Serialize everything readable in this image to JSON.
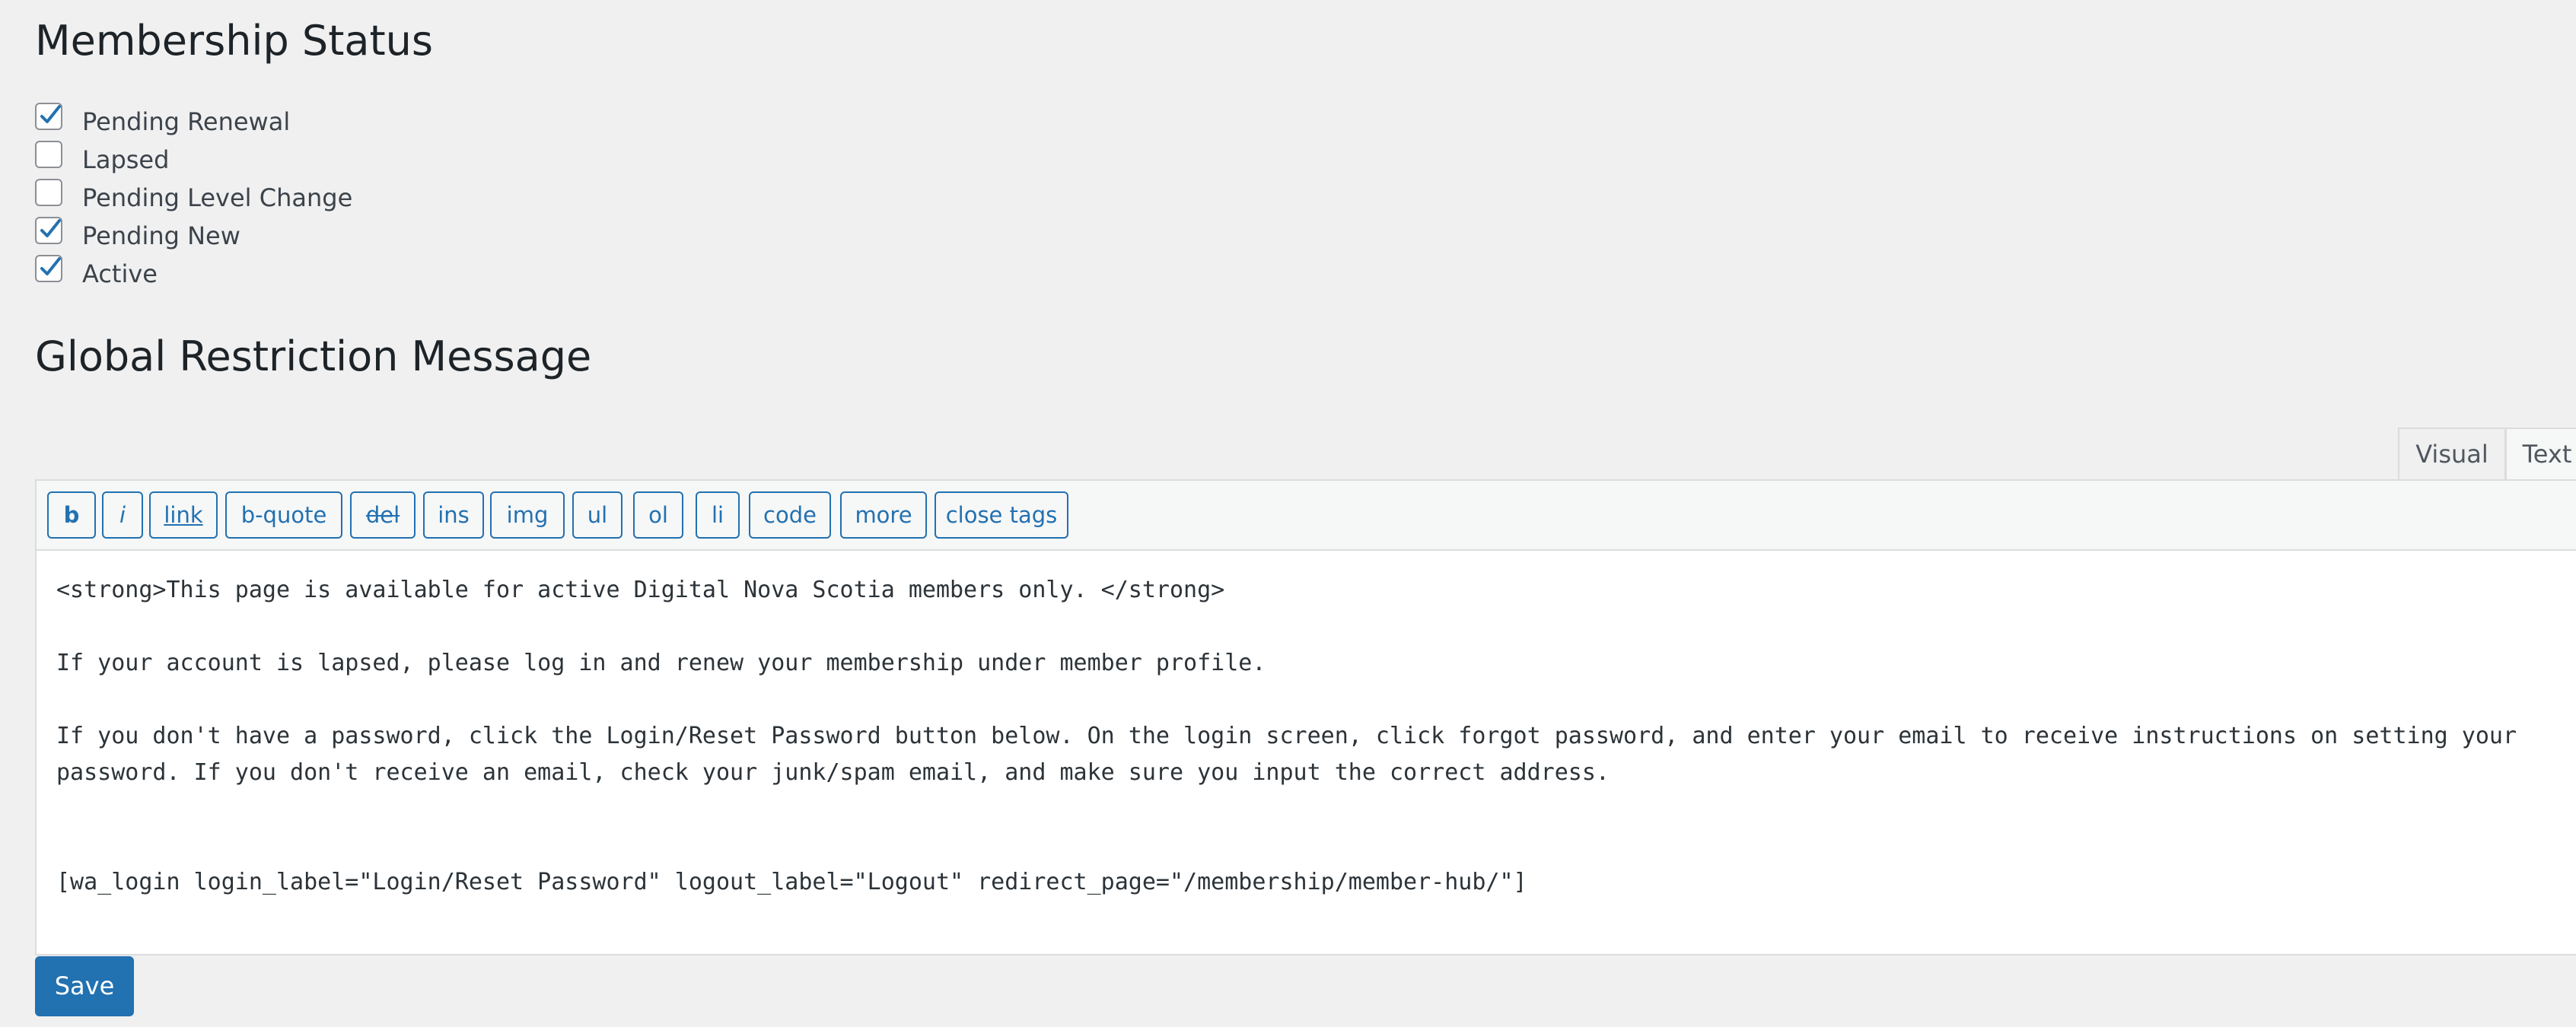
{
  "membership_status": {
    "title": "Membership Status",
    "options": [
      {
        "label": "Pending Renewal",
        "checked": true
      },
      {
        "label": "Lapsed",
        "checked": false
      },
      {
        "label": "Pending Level Change",
        "checked": false
      },
      {
        "label": "Pending New",
        "checked": true
      },
      {
        "label": "Active",
        "checked": true
      }
    ]
  },
  "global_restriction": {
    "title": "Global Restriction Message"
  },
  "editor": {
    "tabs": {
      "visual": "Visual",
      "text": "Text"
    },
    "active_tab": "Text",
    "quicktags": [
      "b",
      "i",
      "link",
      "b-quote",
      "del",
      "ins",
      "img",
      "ul",
      "ol",
      "li",
      "code",
      "more",
      "close tags"
    ],
    "content": "<strong>This page is available for active Digital Nova Scotia members only. </strong>\n\nIf your account is lapsed, please log in and renew your membership under member profile.\n\nIf you don't have a password, click the Login/Reset Password button below. On the login screen, click forgot password, and enter your email to receive instructions on setting your password. If you don't receive an email, check your junk/spam email, and make sure you input the correct address.\n\n\n[wa_login login_label=\"Login/Reset Password\" logout_label=\"Logout\" redirect_page=\"/membership/member-hub/\"]"
  },
  "actions": {
    "save_label": "Save"
  },
  "colors": {
    "accent": "#2271b1",
    "background": "#f0f0f1",
    "text": "#1d2327"
  }
}
